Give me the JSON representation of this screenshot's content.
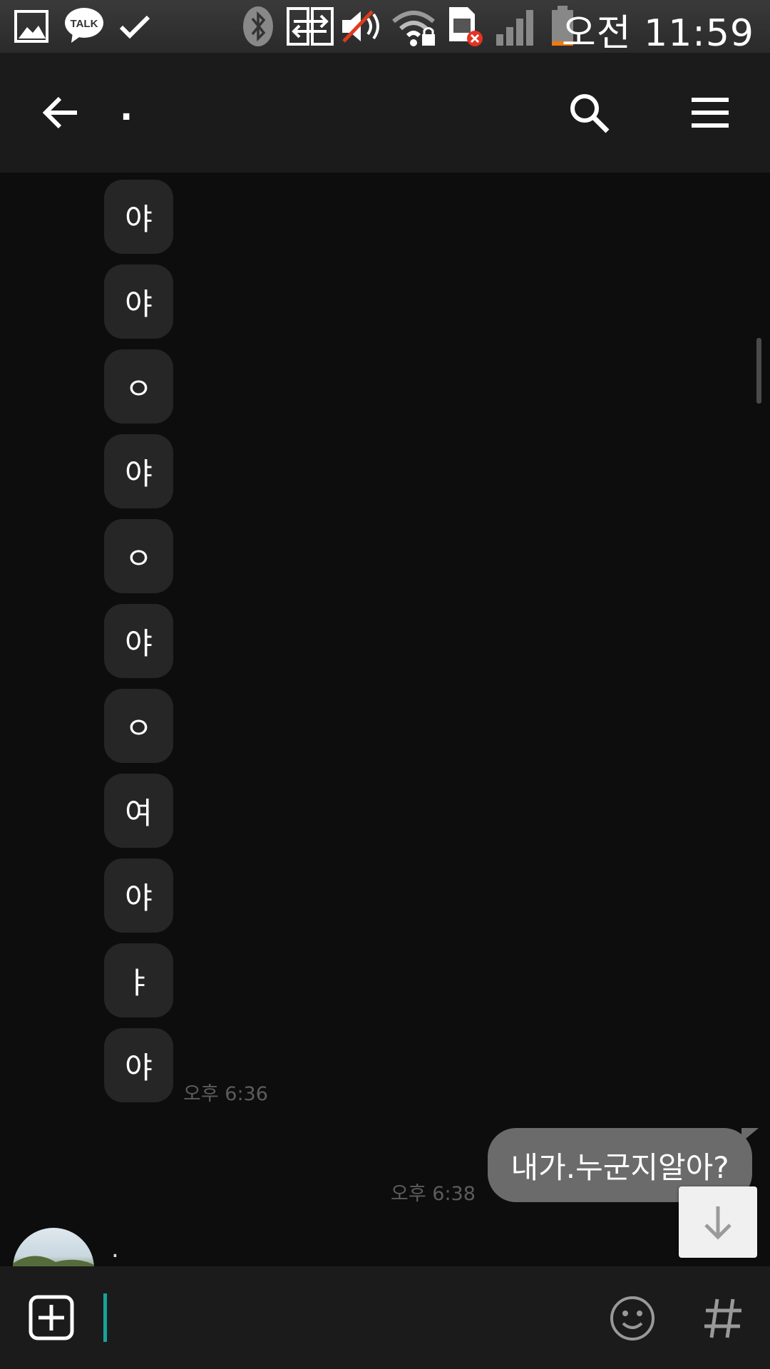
{
  "status_bar": {
    "time": "오전 11:59",
    "icons": [
      "gallery-icon",
      "kakaotalk-icon",
      "check-icon",
      "bluetooth-icon",
      "data-transfer-icon",
      "mute-icon",
      "wifi-lock-icon",
      "sim-error-icon",
      "signal-icon",
      "battery-icon"
    ],
    "talk_label": "TALK"
  },
  "header": {
    "title": ".",
    "back_icon": "back-arrow-icon",
    "search_icon": "search-icon",
    "menu_icon": "menu-icon"
  },
  "messages_in": [
    {
      "text": "야"
    },
    {
      "text": "야"
    },
    {
      "text": "ㅇ"
    },
    {
      "text": "야"
    },
    {
      "text": "ㅇ"
    },
    {
      "text": "야"
    },
    {
      "text": "ㅇ"
    },
    {
      "text": "여"
    },
    {
      "text": "야"
    },
    {
      "text": "ㅑ"
    },
    {
      "text": "야"
    }
  ],
  "time_in": "오후 6:36",
  "message_out": {
    "text": "내가.누군지알아?",
    "time": "오후 6:38"
  },
  "next_sender": {
    "name": ".",
    "avatar": "avatar-photo"
  },
  "input_bar": {
    "value": "",
    "add_icon": "add-icon",
    "emoji_icon": "emoji-icon",
    "hashtag_icon": "hashtag-icon"
  },
  "colors": {
    "background": "#0d0d0d",
    "header": "#1b1b1b",
    "bubble_in": "#262626",
    "bubble_out": "#6b6b6b",
    "cursor": "#15a39a"
  }
}
